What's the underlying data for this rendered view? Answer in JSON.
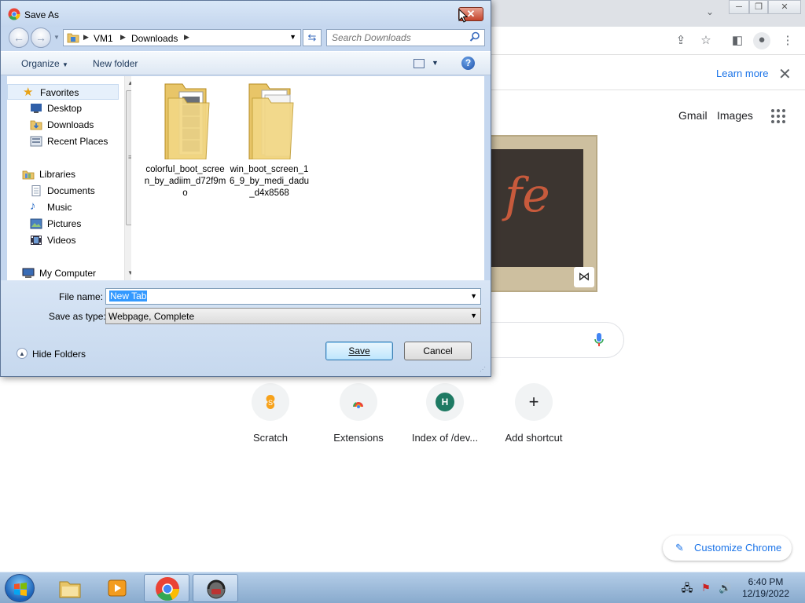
{
  "dialog": {
    "title": "Save As",
    "address": [
      "VM1",
      "Downloads"
    ],
    "search_placeholder": "Search Downloads",
    "toolbar": {
      "organize": "Organize",
      "new_folder": "New folder"
    },
    "nav": {
      "favorites": "Favorites",
      "favorites_items": [
        "Desktop",
        "Downloads",
        "Recent Places"
      ],
      "libraries": "Libraries",
      "libraries_items": [
        "Documents",
        "Music",
        "Pictures",
        "Videos"
      ],
      "computer": "My Computer"
    },
    "files": [
      {
        "name": "colorful_boot_screen_by_adiim_d72f9mo"
      },
      {
        "name": "win_boot_screen_16_9_by_medi_dadu_d4x8568"
      }
    ],
    "file_name_label": "File name:",
    "file_name_value": "New Tab",
    "save_type_label": "Save as type:",
    "save_type_value": "Webpage, Complete",
    "hide_folders": "Hide Folders",
    "save_button": "Save",
    "cancel_button": "Cancel",
    "colors": {
      "selection": "#3399ff",
      "help": "#1c4fa7"
    }
  },
  "chrome": {
    "infobar_learn_more": "Learn more",
    "links": {
      "gmail": "Gmail",
      "images": "Images"
    },
    "doodle_text": "fe",
    "shortcuts": [
      {
        "label": "Scratch",
        "icon": "scratch-icon"
      },
      {
        "label": "Extensions",
        "icon": "chrome-web-store-icon"
      },
      {
        "label": "Index of /dev...",
        "letter": "H"
      },
      {
        "label": "Add shortcut",
        "icon": "plus-icon"
      }
    ],
    "customize": "Customize Chrome",
    "accent": "#1a73e8"
  },
  "taskbar": {
    "items": [
      "explorer",
      "media-player",
      "chrome",
      "app"
    ],
    "clock_time": "6:40 PM",
    "clock_date": "12/19/2022"
  }
}
